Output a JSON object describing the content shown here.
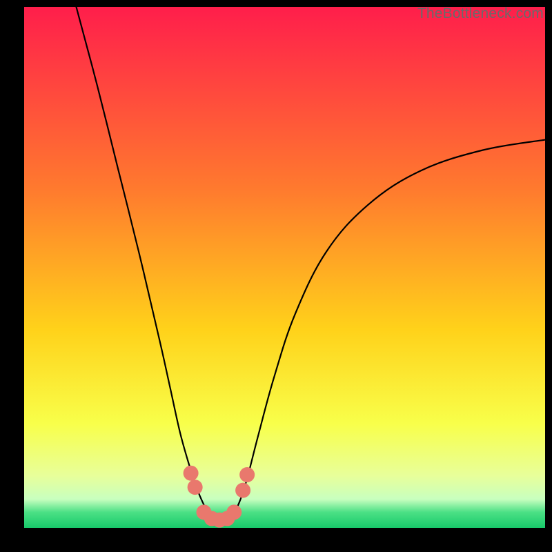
{
  "watermark": "TheBottleneck.com",
  "chart_data": {
    "type": "line",
    "title": "",
    "xlabel": "",
    "ylabel": "",
    "xlim": [
      0,
      100
    ],
    "ylim": [
      0,
      100
    ],
    "background_gradient_stops": [
      {
        "offset": 0.0,
        "color": "#ff1e4b"
      },
      {
        "offset": 0.35,
        "color": "#ff7a2e"
      },
      {
        "offset": 0.62,
        "color": "#ffd21a"
      },
      {
        "offset": 0.8,
        "color": "#f8ff4a"
      },
      {
        "offset": 0.9,
        "color": "#e8ff9a"
      },
      {
        "offset": 0.945,
        "color": "#c8ffbf"
      },
      {
        "offset": 0.97,
        "color": "#4be085"
      },
      {
        "offset": 1.0,
        "color": "#18c96a"
      }
    ],
    "series": [
      {
        "name": "bottleneck-curve",
        "x": [
          10,
          14,
          18,
          22,
          26,
          28,
          30,
          32,
          33,
          34,
          35,
          36,
          37,
          38,
          39,
          40,
          41,
          42,
          43,
          45,
          48,
          52,
          58,
          66,
          76,
          88,
          100
        ],
        "values": [
          100,
          85,
          69,
          53,
          36,
          27,
          18,
          11,
          8,
          5.5,
          3.5,
          2.2,
          1.5,
          1.2,
          1.5,
          2.4,
          4.2,
          6.8,
          10.2,
          18,
          29,
          41,
          53,
          62,
          68.5,
          72.5,
          74.5
        ]
      }
    ],
    "markers": {
      "name": "highlight-points",
      "color": "#e9786d",
      "radius": 11,
      "points": [
        {
          "x": 32.0,
          "y": 10.5
        },
        {
          "x": 32.8,
          "y": 7.8
        },
        {
          "x": 34.5,
          "y": 3.0
        },
        {
          "x": 36.0,
          "y": 1.8
        },
        {
          "x": 37.5,
          "y": 1.5
        },
        {
          "x": 39.0,
          "y": 1.8
        },
        {
          "x": 40.3,
          "y": 3.0
        },
        {
          "x": 42.0,
          "y": 7.2
        },
        {
          "x": 42.8,
          "y": 10.2
        }
      ]
    }
  }
}
